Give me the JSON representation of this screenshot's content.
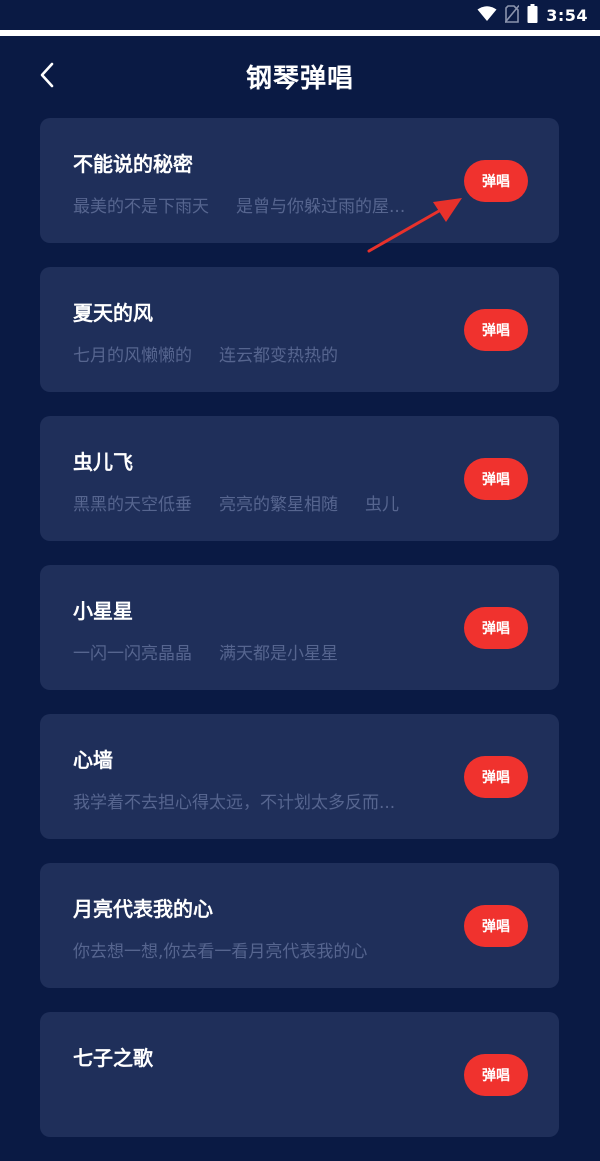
{
  "status_bar": {
    "time": "3:54",
    "icons": [
      "wifi-icon",
      "no-sim-icon",
      "battery-icon"
    ]
  },
  "header": {
    "title": "钢琴弹唱",
    "back_icon": "chevron-left-icon"
  },
  "songs": [
    {
      "title": "不能说的秘密",
      "lyric": "最美的不是下雨天     是曾与你躲过雨的屋...",
      "button": "弹唱"
    },
    {
      "title": "夏天的风",
      "lyric": "七月的风懒懒的     连云都变热热的",
      "button": "弹唱"
    },
    {
      "title": "虫儿飞",
      "lyric": "黑黑的天空低垂     亮亮的繁星相随     虫儿",
      "button": "弹唱"
    },
    {
      "title": "小星星",
      "lyric": "一闪一闪亮晶晶     满天都是小星星",
      "button": "弹唱"
    },
    {
      "title": "心墙",
      "lyric": "我学着不去担心得太远，不计划太多反而...",
      "button": "弹唱"
    },
    {
      "title": "月亮代表我的心",
      "lyric": "你去想一想,你去看一看月亮代表我的心",
      "button": "弹唱"
    },
    {
      "title": "七子之歌",
      "lyric": "",
      "button": "弹唱"
    }
  ],
  "colors": {
    "background": "#0a1a44",
    "card": "#1f2f5a",
    "accent": "#f0322e",
    "lyric_text": "#56658f",
    "annotation_arrow": "#e8312b"
  }
}
